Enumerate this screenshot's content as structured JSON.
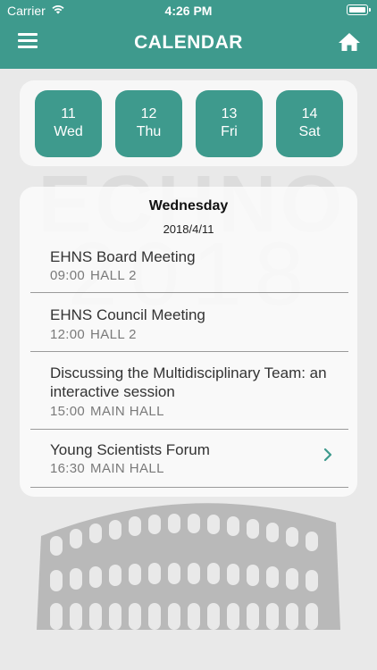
{
  "status_bar": {
    "carrier": "Carrier",
    "time": "4:26 PM"
  },
  "header": {
    "title": "CALENDAR",
    "menu_icon": "hamburger-menu-icon",
    "home_icon": "home-icon"
  },
  "background": {
    "logo_word": "ECHNO",
    "logo_year": "2018"
  },
  "days": [
    {
      "num": "11",
      "weekday": "Wed"
    },
    {
      "num": "12",
      "weekday": "Thu"
    },
    {
      "num": "13",
      "weekday": "Fri"
    },
    {
      "num": "14",
      "weekday": "Sat"
    }
  ],
  "schedule": {
    "weekday": "Wednesday",
    "date": "2018/4/11",
    "events": [
      {
        "title": "EHNS Board Meeting",
        "time": "09:00",
        "hall": "HALL 2"
      },
      {
        "title": "EHNS Council Meeting",
        "time": "12:00",
        "hall": "HALL 2"
      },
      {
        "title": "Discussing the Multidisciplinary Team: an interactive session",
        "time": "15:00",
        "hall": "MAIN HALL"
      },
      {
        "title": "Young Scientists Forum",
        "time": "16:30",
        "hall": "MAIN HALL"
      }
    ]
  },
  "colors": {
    "accent": "#3e9a8d",
    "background": "#e9e9e9",
    "card": "#f7f7f7"
  }
}
